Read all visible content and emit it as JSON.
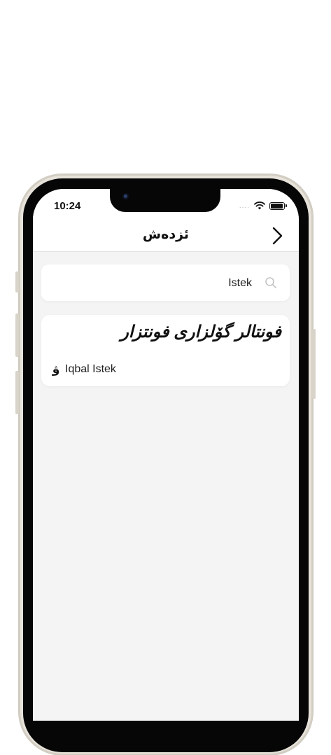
{
  "status_bar": {
    "time": "10:24",
    "signal": "....",
    "icons": [
      "wifi-icon",
      "battery-icon"
    ]
  },
  "nav": {
    "title": "ئزدەش",
    "arrow_icon": "chevron-right-icon"
  },
  "search": {
    "value": "Istek",
    "icon": "search-icon"
  },
  "results": [
    {
      "preview_text": "فونتالر گۆلزاری فونتزار",
      "icon_glyph": "ۋ",
      "font_name": "Iqbal Istek"
    }
  ],
  "colors": {
    "screen_background": "#f4f4f4",
    "card_background": "#ffffff",
    "text": "#111111",
    "frame": "#e7e3da"
  }
}
